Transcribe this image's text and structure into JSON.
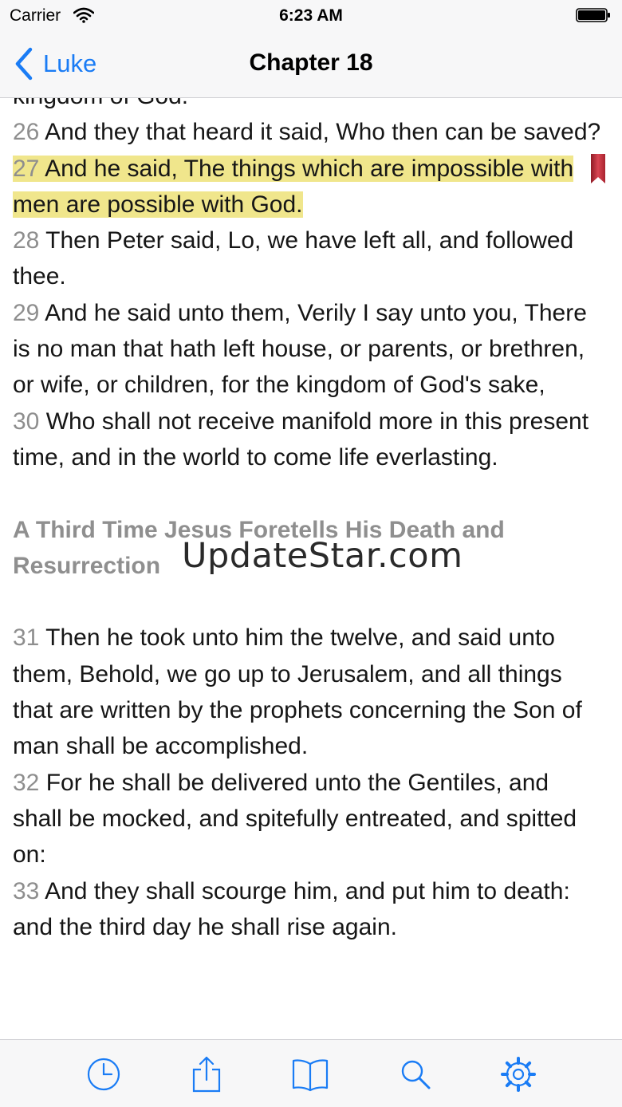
{
  "status": {
    "carrier": "Carrier",
    "time": "6:23 AM"
  },
  "nav": {
    "back_label": "Luke",
    "title": "Chapter 18"
  },
  "reading": {
    "partial_top": "kingdom of God.",
    "verses_a": [
      {
        "num": "26",
        "text": "And they that heard it said, Who then can be saved?"
      },
      {
        "num": "27",
        "text": "And he said, The things which are impossible with men are possible with God.",
        "highlighted": true,
        "bookmarked": true
      },
      {
        "num": "28",
        "text": "Then Peter said, Lo, we have left all, and followed thee."
      },
      {
        "num": "29",
        "text": "And he said unto them, Verily I say unto you, There is no man that hath left house, or parents, or brethren, or wife, or children, for the kingdom of God's sake,"
      },
      {
        "num": "30",
        "text": "Who shall not receive manifold more in this present time, and in the world to come life everlasting."
      }
    ],
    "section_heading": "A Third Time Jesus Foretells His Death and Resurrection",
    "verses_b": [
      {
        "num": "31",
        "text": "Then he took unto him the twelve, and said unto them, Behold, we go up to Jerusalem, and all things that are written by the prophets concerning the Son of man shall be accomplished."
      },
      {
        "num": "32",
        "text": "For he shall be delivered unto the Gentiles, and shall be mocked, and spitefully entreated, and spitted on:"
      },
      {
        "num": "33",
        "text": "And they shall scourge him, and put him to death: and the third day he shall rise again."
      }
    ]
  },
  "watermark": "UpdateStar.com",
  "tabbar": {
    "items": [
      "history-icon",
      "share-icon",
      "book-icon",
      "search-icon",
      "gear-icon"
    ]
  },
  "colors": {
    "accent": "#1a7cf5",
    "highlight": "#f0e68c",
    "verse_number": "#8e8e8e",
    "heading": "#8f8f8f",
    "bookmark": "#c62d3a"
  }
}
